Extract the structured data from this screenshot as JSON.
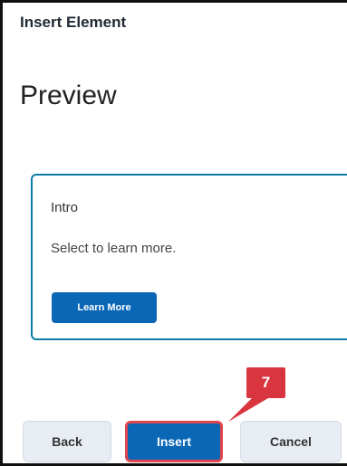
{
  "dialog": {
    "title": "Insert Element",
    "heading": "Preview"
  },
  "card": {
    "title": "Intro",
    "text": "Select to learn more.",
    "button_label": "Learn More"
  },
  "footer": {
    "back_label": "Back",
    "insert_label": "Insert",
    "cancel_label": "Cancel"
  },
  "annotation": {
    "step_number": "7",
    "color": "#d9353f"
  },
  "colors": {
    "accent": "#0a67b5",
    "card_border": "#0a7da7"
  }
}
